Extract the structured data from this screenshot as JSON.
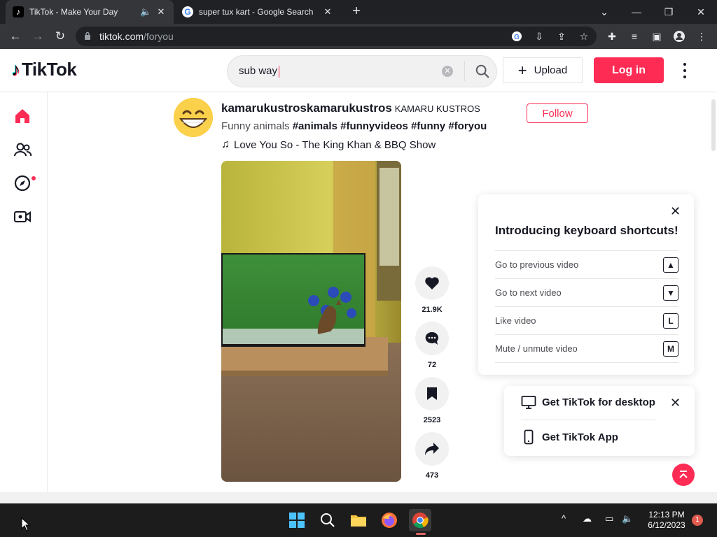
{
  "browser": {
    "tabs": [
      {
        "title": "TikTok - Make Your Day",
        "active": true
      },
      {
        "title": "super tux kart - Google Search",
        "active": false
      }
    ],
    "url_host": "tiktok.com",
    "url_path": "/foryou"
  },
  "header": {
    "logo_text": "TikTok",
    "search_value": "sub way",
    "upload_label": "Upload",
    "login_label": "Log in"
  },
  "post": {
    "username": "kamarukustroskamarukustros",
    "nickname": "KAMARU KUSTROS",
    "caption_text": "Funny animals",
    "hashtags": [
      "#animals",
      "#funnyvideos",
      "#funny",
      "#foryou"
    ],
    "music": "Love You So - The King Khan & BBQ Show",
    "follow_label": "Follow",
    "likes": "21.9K",
    "comments": "72",
    "saves": "2523",
    "shares": "473"
  },
  "shortcuts": {
    "title": "Introducing keyboard shortcuts!",
    "items": [
      {
        "label": "Go to previous video",
        "key": "▲"
      },
      {
        "label": "Go to next video",
        "key": "▼"
      },
      {
        "label": "Like video",
        "key": "L"
      },
      {
        "label": "Mute / unmute video",
        "key": "M"
      }
    ]
  },
  "get_app": {
    "desktop_label": "Get TikTok for desktop",
    "app_label": "Get TikTok App"
  },
  "taskbar": {
    "time": "12:13 PM",
    "date": "6/12/2023",
    "notifications": "1"
  },
  "colors": {
    "brand": "#fe2c55",
    "chrome_dark": "#202124",
    "chrome_toolbar": "#35363a"
  }
}
